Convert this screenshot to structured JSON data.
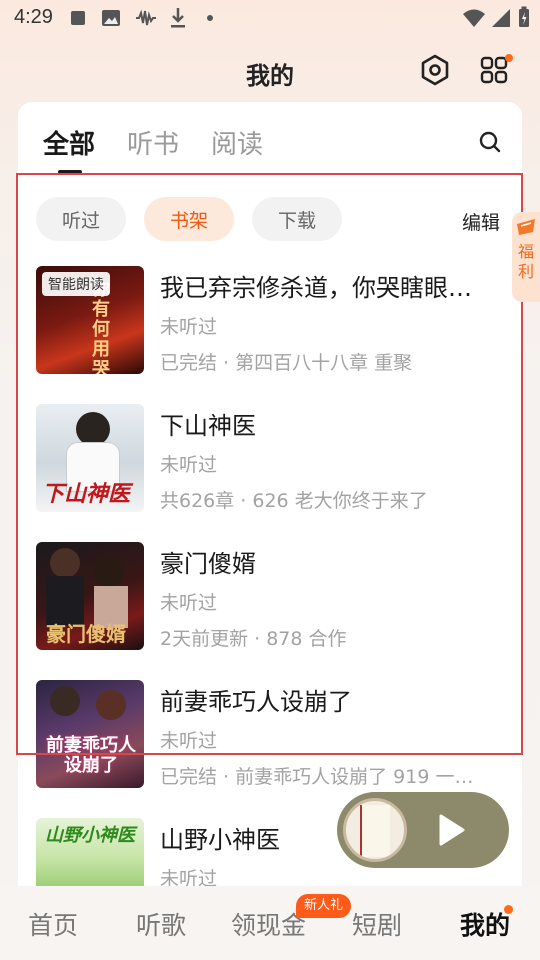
{
  "status_bar": {
    "time": "4:29",
    "icons": [
      "stop-square-icon",
      "image-icon",
      "audio-wave-icon",
      "download-icon",
      "dot-icon",
      "wifi-icon",
      "signal-icon",
      "battery-icon"
    ]
  },
  "header": {
    "title": "我的",
    "icons": [
      "settings-hex-icon",
      "apps-grid-icon"
    ]
  },
  "tabs": {
    "items": [
      {
        "label": "全部",
        "active": true
      },
      {
        "label": "听书",
        "active": false
      },
      {
        "label": "阅读",
        "active": false
      }
    ],
    "search_icon": "search-icon"
  },
  "filters": {
    "chips": [
      {
        "label": "听过",
        "active": false
      },
      {
        "label": "书架",
        "active": true
      },
      {
        "label": "下载",
        "active": false
      }
    ],
    "edit_label": "编辑"
  },
  "books": [
    {
      "cover_label": "智能朗读",
      "title": "我已弃宗修杀道，你哭瞎眼…",
      "status": "未听过",
      "meta": "已完结 · 第四百八十八章 重聚"
    },
    {
      "cover_label": "",
      "title": "下山神医",
      "status": "未听过",
      "meta": "共626章 · 626 老大你终于来了"
    },
    {
      "cover_label": "",
      "title": "豪门傻婿",
      "status": "未听过",
      "meta": "2天前更新 · 878 合作"
    },
    {
      "cover_label": "",
      "title": "前妻乖巧人设崩了",
      "status": "未听过",
      "meta": "已完结 · 前妻乖巧人设崩了 919 一…"
    },
    {
      "cover_label": "",
      "title": "山野小神医",
      "status": "未听过",
      "meta": ""
    }
  ],
  "covers_text": [
    "你有何用 哭瞎眼",
    "下山神医",
    "豪门傻婿",
    "前妻乖巧人设崩了",
    "山野小神医"
  ],
  "welfare": {
    "label": "福利"
  },
  "player": {
    "icon": "play-icon"
  },
  "bottom_nav": {
    "items": [
      {
        "label": "首页",
        "active": false
      },
      {
        "label": "听歌",
        "active": false
      },
      {
        "label": "领现金",
        "active": false
      },
      {
        "label": "短剧",
        "active": false
      },
      {
        "label": "我的",
        "active": true
      }
    ],
    "badge": "新人礼"
  },
  "colors": {
    "accent": "#f25a12",
    "highlight_box": "#d94848"
  }
}
